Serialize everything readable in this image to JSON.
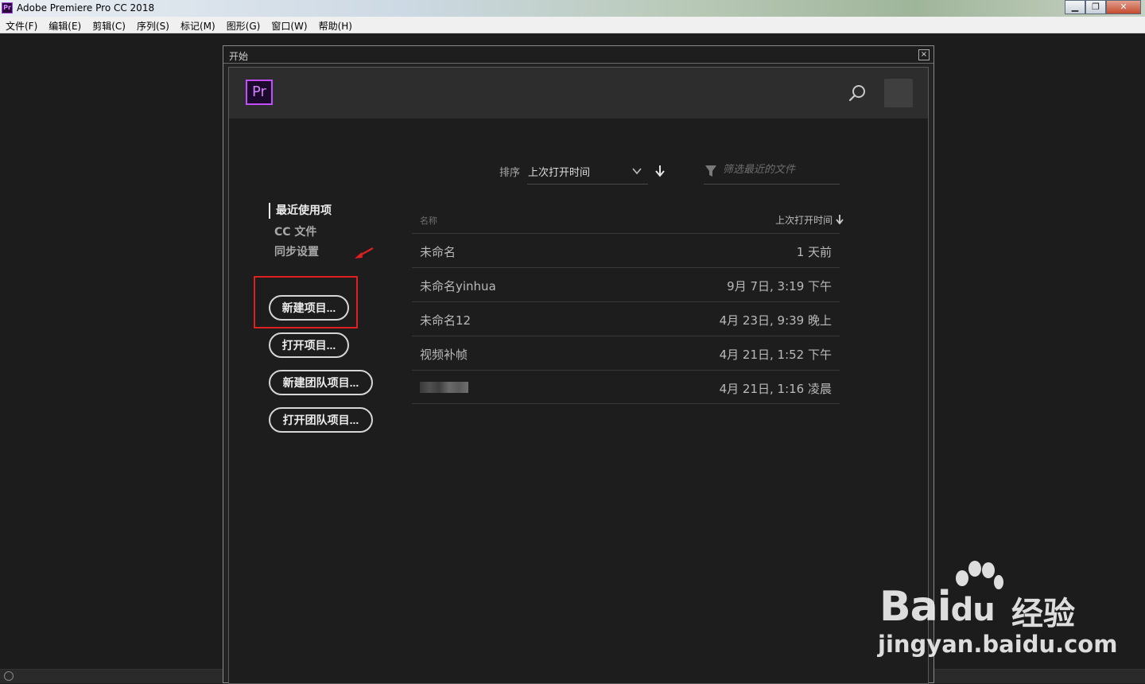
{
  "window": {
    "title": "Adobe Premiere Pro CC 2018",
    "app_icon_text": "Pr",
    "minimize": "▁",
    "restore": "❐",
    "close": "✕"
  },
  "menu": [
    "文件(F)",
    "编辑(E)",
    "剪辑(C)",
    "序列(S)",
    "标记(M)",
    "图形(G)",
    "窗口(W)",
    "帮助(H)"
  ],
  "dialog": {
    "title": "开始",
    "close": "×",
    "logo": "Pr"
  },
  "sort": {
    "label": "排序",
    "value": "上次打开时间"
  },
  "filter": {
    "placeholder": "筛选最近的文件"
  },
  "nav": {
    "recent": "最近使用项",
    "cc_files": "CC 文件",
    "sync": "同步设置"
  },
  "buttons": {
    "new_project": "新建项目...",
    "open_project": "打开项目...",
    "new_team_project": "新建团队项目...",
    "open_team_project": "打开团队项目..."
  },
  "table": {
    "col_name": "名称",
    "col_time": "上次打开时间",
    "rows": [
      {
        "name": "未命名",
        "time": "1 天前"
      },
      {
        "name": "未命名yinhua",
        "time": "9月 7日, 3:19 下午"
      },
      {
        "name": "未命名12",
        "time": "4月 23日, 9:39 晚上"
      },
      {
        "name": "视频补帧",
        "time": "4月 21日, 1:52 下午"
      },
      {
        "name": "",
        "time": "4月 21日, 1:16 凌晨"
      }
    ]
  },
  "watermark": {
    "brand": "Bai",
    "brand2": "du",
    "product": "经验",
    "url": "jingyan.baidu.com"
  },
  "colors": {
    "accent_purple": "#c44dff",
    "highlight_red": "#e02020"
  }
}
